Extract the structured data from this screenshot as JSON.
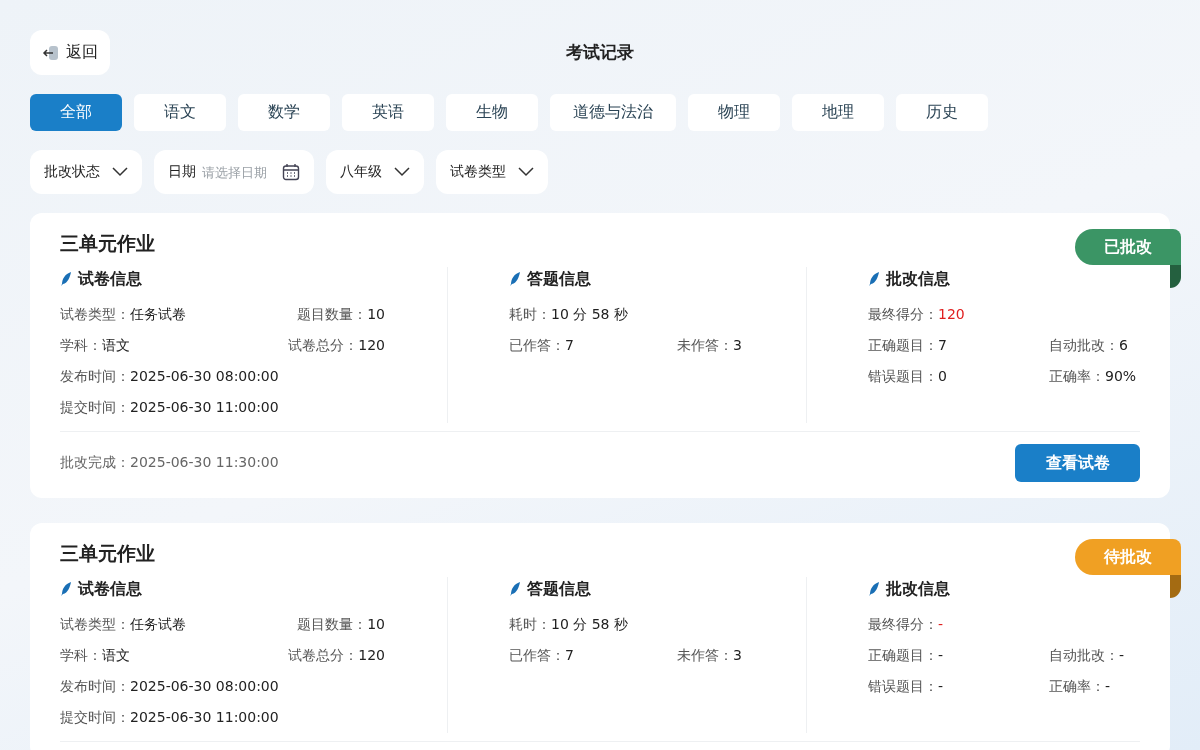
{
  "header": {
    "back": "返回",
    "title": "考试记录"
  },
  "tabs": [
    {
      "label": "全部",
      "selected": true
    },
    {
      "label": "语文",
      "selected": false
    },
    {
      "label": "数学",
      "selected": false
    },
    {
      "label": "英语",
      "selected": false
    },
    {
      "label": "生物",
      "selected": false
    },
    {
      "label": "道德与法治",
      "selected": false
    },
    {
      "label": "物理",
      "selected": false
    },
    {
      "label": "地理",
      "selected": false
    },
    {
      "label": "历史",
      "selected": false
    }
  ],
  "filters": [
    {
      "kind": "dropdown",
      "label": "批改状态"
    },
    {
      "kind": "date",
      "label": "日期",
      "placeholder": "请选择日期"
    },
    {
      "kind": "dropdown",
      "label": "八年级"
    },
    {
      "kind": "dropdown",
      "label": "试卷类型"
    }
  ],
  "records": [
    {
      "title": "三单元作业",
      "status": {
        "label": "已批改",
        "kind": "graded"
      },
      "sections": [
        {
          "heading": "试卷信息",
          "rows": [
            [
              {
                "label": "试卷类型：",
                "value": "任务试卷"
              },
              {
                "label": "题目数量：",
                "value": "10"
              }
            ],
            [
              {
                "label": "学科：",
                "value": "语文"
              },
              {
                "label": "试卷总分：",
                "value": "120"
              }
            ],
            [
              {
                "label": "发布时间：",
                "value": "2025-06-30 08:00:00"
              }
            ],
            [
              {
                "label": "提交时间：",
                "value": "2025-06-30 11:00:00"
              }
            ]
          ]
        },
        {
          "heading": "答题信息",
          "rows": [
            [
              {
                "label": "耗时：",
                "value": "10 分 58 秒"
              }
            ],
            [
              {
                "label": "已作答：",
                "value": "7"
              },
              {
                "label": "未作答：",
                "value": "3"
              }
            ]
          ]
        },
        {
          "heading": "批改信息",
          "rows": [
            [
              {
                "label": "最终得分：",
                "value": "120",
                "highlight": true
              }
            ],
            [
              {
                "label": "正确题目：",
                "value": "7"
              },
              {
                "label": "自动批改：",
                "value": "6"
              }
            ],
            [
              {
                "label": "错误题目：",
                "value": "0"
              },
              {
                "label": "正确率：",
                "value": "90%"
              }
            ]
          ]
        }
      ],
      "footer": {
        "text": "批改完成：2025-06-30 11:30:00",
        "button": "查看试卷"
      }
    },
    {
      "title": "三单元作业",
      "status": {
        "label": "待批改",
        "kind": "pending"
      },
      "sections": [
        {
          "heading": "试卷信息",
          "rows": [
            [
              {
                "label": "试卷类型：",
                "value": "任务试卷"
              },
              {
                "label": "题目数量：",
                "value": "10"
              }
            ],
            [
              {
                "label": "学科：",
                "value": "语文"
              },
              {
                "label": "试卷总分：",
                "value": "120"
              }
            ],
            [
              {
                "label": "发布时间：",
                "value": "2025-06-30 08:00:00"
              }
            ],
            [
              {
                "label": "提交时间：",
                "value": "2025-06-30 11:00:00"
              }
            ]
          ]
        },
        {
          "heading": "答题信息",
          "rows": [
            [
              {
                "label": "耗时：",
                "value": "10 分 58 秒"
              }
            ],
            [
              {
                "label": "已作答：",
                "value": "7"
              },
              {
                "label": "未作答：",
                "value": "3"
              }
            ]
          ]
        },
        {
          "heading": "批改信息",
          "rows": [
            [
              {
                "label": "最终得分：",
                "value": "-",
                "highlight": true
              }
            ],
            [
              {
                "label": "正确题目：",
                "value": "-"
              },
              {
                "label": "自动批改：",
                "value": "-"
              }
            ],
            [
              {
                "label": "错误题目：",
                "value": "-"
              },
              {
                "label": "正确率：",
                "value": "-"
              }
            ]
          ]
        }
      ]
    }
  ]
}
